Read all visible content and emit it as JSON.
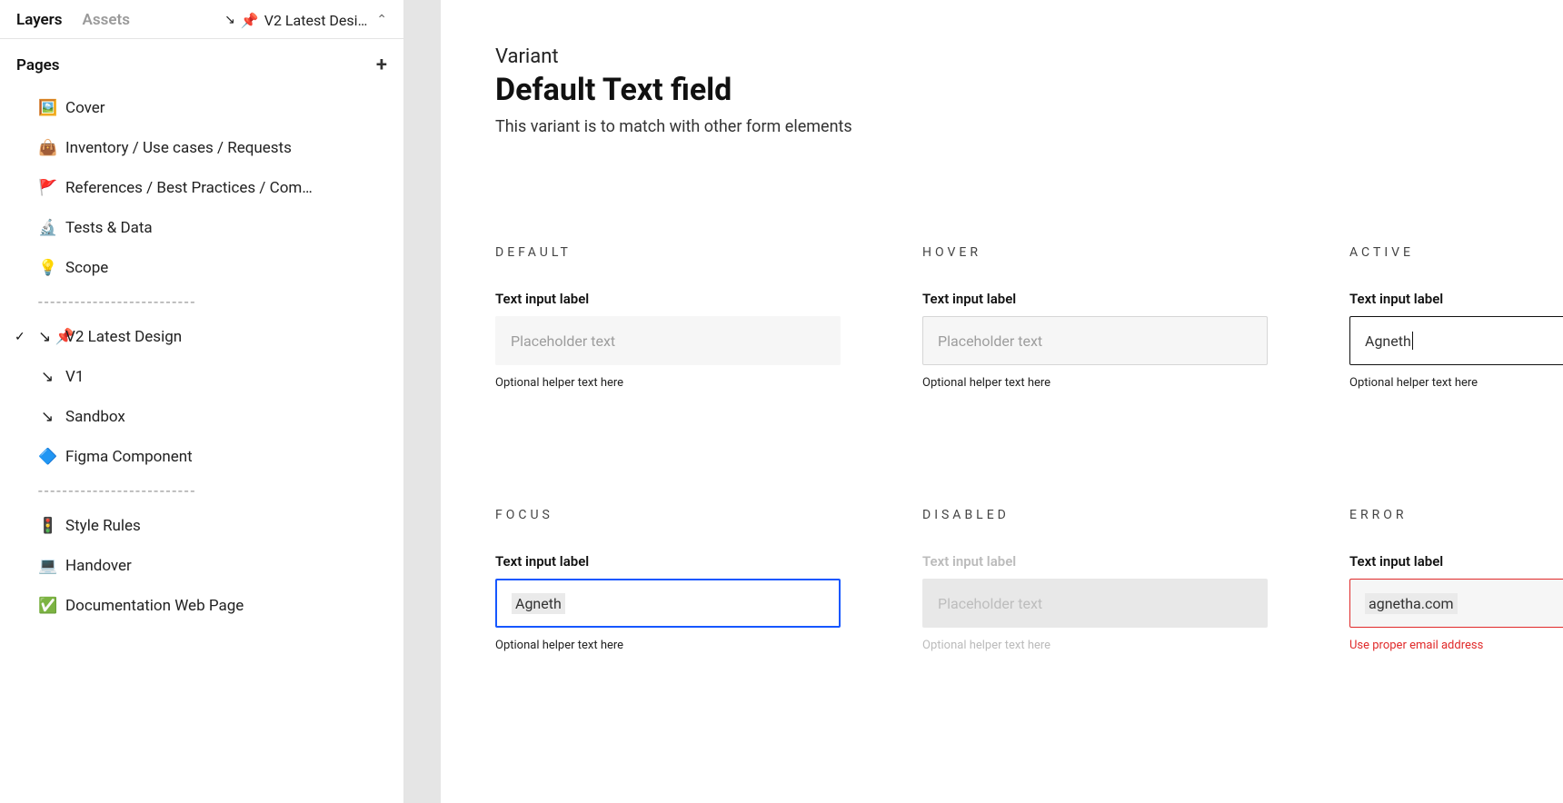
{
  "sidebar": {
    "tabs": {
      "layers": "Layers",
      "assets": "Assets"
    },
    "currentPage": {
      "arrow": "↘",
      "pin": "📌",
      "label": "V2 Latest Desi…"
    },
    "pagesHeader": "Pages",
    "pages": [
      {
        "icon": "🖼️",
        "label": "Cover"
      },
      {
        "icon": "👜",
        "label": "Inventory / Use cases / Requests"
      },
      {
        "icon": "🚩",
        "label": "References  / Best Practices / Com…"
      },
      {
        "icon": "🔬",
        "label": "Tests & Data"
      },
      {
        "icon": "💡",
        "label": "Scope"
      },
      {
        "sep": true,
        "label": "--------------------------"
      },
      {
        "icon": "↘ 📌",
        "label": "V2  Latest Design",
        "active": true
      },
      {
        "icon": "↘",
        "label": "V1"
      },
      {
        "icon": "↘",
        "label": "Sandbox"
      },
      {
        "icon": "🔷",
        "label": "Figma Component"
      },
      {
        "sep": true,
        "label": "--------------------------"
      },
      {
        "icon": "🚦",
        "label": "Style Rules"
      },
      {
        "icon": "💻",
        "label": "Handover"
      },
      {
        "icon": "✅",
        "label": "Documentation Web Page"
      }
    ]
  },
  "canvas": {
    "variantLabel": "Variant",
    "title": "Default Text field",
    "description": "This variant is to match with other form elements",
    "states": {
      "default": {
        "name": "DEFAULT",
        "label": "Text input label",
        "placeholder": "Placeholder text",
        "helper": "Optional helper text here"
      },
      "hover": {
        "name": "HOVER",
        "label": "Text input label",
        "placeholder": "Placeholder text",
        "helper": "Optional helper text here"
      },
      "active": {
        "name": "ACTIVE",
        "label": "Text input label",
        "value": "Agneth",
        "helper": "Optional helper text here"
      },
      "focus": {
        "name": "FOCUS",
        "label": "Text input label",
        "value": "Agneth",
        "helper": "Optional helper text here"
      },
      "disabled": {
        "name": "DISABLED",
        "label": "Text input label",
        "placeholder": "Placeholder text",
        "helper": "Optional helper text here"
      },
      "error": {
        "name": "ERROR",
        "label": "Text input label",
        "value": "agnetha.com",
        "helper": "Use proper email address"
      }
    }
  }
}
